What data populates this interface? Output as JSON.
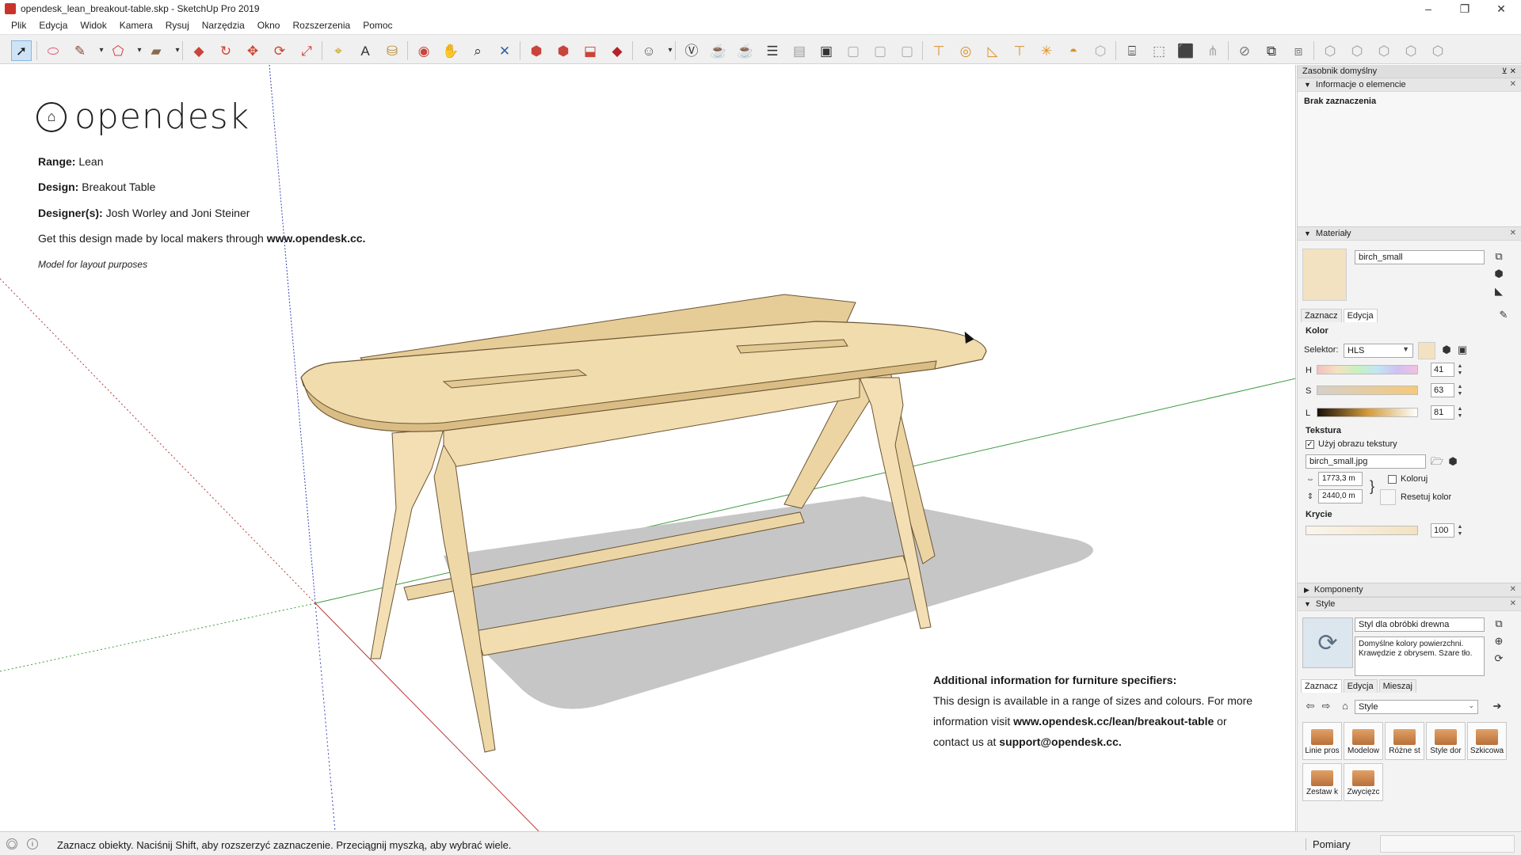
{
  "window": {
    "title": "opendesk_lean_breakout-table.skp - SketchUp Pro 2019",
    "minimize": "–",
    "restore": "❐",
    "close": "✕"
  },
  "menu": [
    "Plik",
    "Edycja",
    "Widok",
    "Kamera",
    "Rysuj",
    "Narzędzia",
    "Okno",
    "Rozszerzenia",
    "Pomoc"
  ],
  "toolbar": {
    "tools": [
      {
        "name": "select-icon",
        "glyph": "➚",
        "color": "#1a1a1a"
      },
      {
        "name": "eraser-icon",
        "glyph": "⬭",
        "color": "#e0567a"
      },
      {
        "name": "pencil-icon",
        "glyph": "✎",
        "color": "#8a4b3a"
      },
      {
        "name": "dropdown-icon",
        "glyph": "▾",
        "color": "#333333"
      },
      {
        "name": "freehand-icon",
        "glyph": "⬠",
        "color": "#d23b3b"
      },
      {
        "name": "dropdown-icon",
        "glyph": "▾",
        "color": "#333333"
      },
      {
        "name": "rectangle-icon",
        "glyph": "▰",
        "color": "#8a6a4a"
      },
      {
        "name": "dropdown-icon",
        "glyph": "▾",
        "color": "#333333"
      },
      {
        "name": "push-pull-icon",
        "glyph": "◆",
        "color": "#c9443a"
      },
      {
        "name": "follow-me-icon",
        "glyph": "↻",
        "color": "#d0432f"
      },
      {
        "name": "move-icon",
        "glyph": "✥",
        "color": "#d0432f"
      },
      {
        "name": "rotate-icon",
        "glyph": "⟳",
        "color": "#d0432f"
      },
      {
        "name": "scale-icon",
        "glyph": "⤢",
        "color": "#d0432f"
      },
      {
        "name": "tape-measure-icon",
        "glyph": "⌖",
        "color": "#c8a020"
      },
      {
        "name": "text-icon",
        "glyph": "A",
        "color": "#333333"
      },
      {
        "name": "paint-bucket-icon",
        "glyph": "⛁",
        "color": "#b8862a"
      },
      {
        "name": "orbit-icon",
        "glyph": "◉",
        "color": "#c9443a"
      },
      {
        "name": "pan-icon",
        "glyph": "✋",
        "color": "#e0a040"
      },
      {
        "name": "zoom-icon",
        "glyph": "⌕",
        "color": "#333333"
      },
      {
        "name": "zoom-extents-icon",
        "glyph": "✕",
        "color": "#3a5fa0"
      },
      {
        "name": "warehouse-icon",
        "glyph": "⬢",
        "color": "#c9443a"
      },
      {
        "name": "share-model-icon",
        "glyph": "⬢",
        "color": "#c9443a"
      },
      {
        "name": "upload-icon",
        "glyph": "⬓",
        "color": "#c9443a"
      },
      {
        "name": "extension-warehouse-icon",
        "glyph": "◆",
        "color": "#b4232a"
      },
      {
        "name": "user-account-icon",
        "glyph": "☺",
        "color": "#555555"
      },
      {
        "name": "dropdown-icon",
        "glyph": "▾",
        "color": "#333333"
      },
      {
        "name": "vray-icon",
        "glyph": "Ⓥ",
        "color": "#333333"
      },
      {
        "name": "render-teapot-icon",
        "glyph": "☕",
        "color": "#333333"
      },
      {
        "name": "interactive-render-icon",
        "glyph": "☕",
        "color": "#555555"
      },
      {
        "name": "frame-buffer-icon",
        "glyph": "☰",
        "color": "#333333"
      },
      {
        "name": "batch-render-icon",
        "glyph": "▤",
        "color": "#999999"
      },
      {
        "name": "asset-editor-icon",
        "glyph": "▣",
        "color": "#333333"
      },
      {
        "name": "lights-icon",
        "glyph": "▢",
        "color": "#aaaaaa"
      },
      {
        "name": "sphere-light-icon",
        "glyph": "▢",
        "color": "#aaaaaa"
      },
      {
        "name": "lock-icon",
        "glyph": "▢",
        "color": "#aaaaaa"
      },
      {
        "name": "rect-light-icon",
        "glyph": "⊤",
        "color": "#d9902a"
      },
      {
        "name": "sphere-light-icon",
        "glyph": "◎",
        "color": "#d9902a"
      },
      {
        "name": "spot-light-icon",
        "glyph": "◺",
        "color": "#d9902a"
      },
      {
        "name": "ies-light-icon",
        "glyph": "⊤",
        "color": "#d9902a"
      },
      {
        "name": "omni-light-icon",
        "glyph": "✳",
        "color": "#d9902a"
      },
      {
        "name": "dome-light-icon",
        "glyph": "◓",
        "color": "#d9902a"
      },
      {
        "name": "mesh-light-icon",
        "glyph": "⬡",
        "color": "#aaaaaa"
      },
      {
        "name": "infinite-plane-icon",
        "glyph": "⌸",
        "color": "#333333"
      },
      {
        "name": "proxy-export-icon",
        "glyph": "⬚",
        "color": "#777777"
      },
      {
        "name": "proxy-import-icon",
        "glyph": "⬛",
        "color": "#333333"
      },
      {
        "name": "fur-icon",
        "glyph": "⋔",
        "color": "#aaaaaa"
      },
      {
        "name": "mesh-clipper-icon",
        "glyph": "⊘",
        "color": "#777777"
      },
      {
        "name": "section-plane-icon",
        "glyph": "⧉",
        "color": "#333333"
      },
      {
        "name": "section-fill-icon",
        "glyph": "⧈",
        "color": "#777777"
      },
      {
        "name": "iso-view-icon",
        "glyph": "⬡",
        "color": "#999999"
      },
      {
        "name": "top-view-icon",
        "glyph": "⬡",
        "color": "#999999"
      },
      {
        "name": "front-view-icon",
        "glyph": "⬡",
        "color": "#999999"
      },
      {
        "name": "right-view-icon",
        "glyph": "⬡",
        "color": "#999999"
      },
      {
        "name": "back-view-icon",
        "glyph": "⬡",
        "color": "#999999"
      }
    ]
  },
  "viewport": {
    "logo_text": "opendesk",
    "info": [
      {
        "label": "Range:",
        "value": "Lean"
      },
      {
        "label": "Design:",
        "value": "Breakout Table"
      },
      {
        "label": "Designer(s):",
        "value": "Josh Worley and Joni Steiner"
      }
    ],
    "made_by_text": "Get this design made by local makers through ",
    "made_by_link": "www.opendesk.cc.",
    "layout_note": "Model for layout purposes",
    "spec": {
      "title": "Additional information for furniture specifiers:",
      "line1": "This design is available in a range of sizes and colours. For more",
      "line2_pre": "information visit ",
      "line2_link": "www.opendesk.cc/lean/breakout-table",
      "line2_post": " or",
      "line3_pre": "contact us at ",
      "line3_link": "support@opendesk.cc."
    },
    "wood_color": "#efd9aa",
    "wood_dark": "#cfb07a"
  },
  "tray": {
    "title": "Zasobnik domyślny",
    "entity_info": {
      "header": "Informacje o elemencie",
      "status": "Brak zaznaczenia"
    },
    "materials": {
      "header": "Materiały",
      "name": "birch_small",
      "tabs": [
        "Zaznacz",
        "Edycja"
      ],
      "color_heading": "Kolor",
      "selector_label": "Selektor:",
      "selector_value": "HLS",
      "swatch_color": "#f3e2c1",
      "h_label": "H",
      "h_value": "41",
      "s_label": "S",
      "s_value": "63",
      "l_label": "L",
      "l_value": "81",
      "texture_heading": "Tekstura",
      "use_texture_label": "Użyj obrazu tekstury",
      "use_texture_checked": true,
      "texture_file": "birch_small.jpg",
      "width_value": "1773,3 m",
      "height_value": "2440,0 m",
      "colorize_label": "Koloruj",
      "reset_color_label": "Resetuj kolor",
      "opacity_heading": "Krycie",
      "opacity_value": "100"
    },
    "components": {
      "header": "Komponenty"
    },
    "styles": {
      "header": "Style",
      "name": "Styl dla obróbki drewna",
      "description": "Domyślne kolory powierzchni. Krawędzie z obrysem. Szare tło.",
      "tabs": [
        "Zaznacz",
        "Edycja",
        "Mieszaj"
      ],
      "library_value": "Style",
      "tiles": [
        "Linie pros",
        "Modelow",
        "Różne st",
        "Style dor",
        "Szkicowa",
        "Zestaw k",
        "Zwycięzc"
      ]
    }
  },
  "statusbar": {
    "hint": "Zaznacz obiekty. Naciśnij Shift, aby rozszerzyć zaznaczenie. Przeciągnij myszką, aby wybrać wiele.",
    "measurements_label": "Pomiary"
  }
}
